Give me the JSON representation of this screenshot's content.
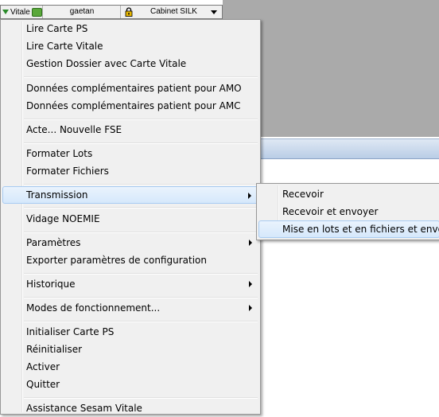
{
  "toolbar": {
    "vitale_label": "Vitale",
    "user": "gaetan",
    "cabinet": "Cabinet SILK"
  },
  "menu": {
    "items": [
      {
        "label": "Lire Carte PS"
      },
      {
        "label": "Lire Carte Vitale"
      },
      {
        "label": "Gestion Dossier avec Carte Vitale"
      },
      {
        "label": "Données complémentaires patient pour AMO"
      },
      {
        "label": "Données complémentaires patient pour AMC"
      },
      {
        "label": "Acte... Nouvelle FSE"
      },
      {
        "label": "Formater Lots"
      },
      {
        "label": "Formater Fichiers"
      },
      {
        "label": "Transmission",
        "submenu": true,
        "highlighted": true
      },
      {
        "label": "Vidage NOEMIE"
      },
      {
        "label": "Paramètres",
        "submenu": true
      },
      {
        "label": "Exporter paramètres de configuration"
      },
      {
        "label": "Historique",
        "submenu": true
      },
      {
        "label": "Modes de fonctionnement...",
        "submenu": true
      },
      {
        "label": "Initialiser Carte PS"
      },
      {
        "label": "Réinitialiser"
      },
      {
        "label": "Activer"
      },
      {
        "label": "Quitter"
      },
      {
        "label": "Assistance Sesam Vitale"
      }
    ]
  },
  "submenu": {
    "items": [
      {
        "label": "Recevoir"
      },
      {
        "label": "Recevoir et envoyer"
      },
      {
        "label": "Mise en lots et en fichiers et envoyer",
        "highlighted": true
      }
    ]
  }
}
